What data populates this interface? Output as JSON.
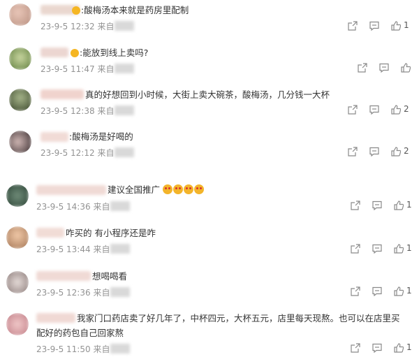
{
  "comments": [
    {
      "text": ":酸梅汤本来就是药房里配制",
      "date": "23-9-5 12:32",
      "source": "来自",
      "likes": "1"
    },
    {
      "text": ":能放到线上卖吗?",
      "date": "23-9-5 11:47",
      "source": "来自",
      "likes": ""
    },
    {
      "text": "真的好想回到小时候，大街上卖大碗茶，酸梅汤，几分钱一大杯",
      "date": "23-9-5 12:38",
      "source": "来自",
      "likes": "2"
    },
    {
      "text": ":酸梅汤是好喝的",
      "date": "23-9-5 12:12",
      "source": "来自",
      "likes": "2"
    },
    {
      "text": "建议全国推广",
      "date": "23-9-5 14:36",
      "source": "来自",
      "likes": "1"
    },
    {
      "text": "咋买的 有小程序还是咋",
      "date": "23-9-5 13:44",
      "source": "来自",
      "likes": "1"
    },
    {
      "text": "想喝喝看",
      "date": "23-9-5 12:36",
      "source": "来自",
      "likes": "1"
    },
    {
      "text": "我家门口药店卖了好几年了，中杯四元，大杯五元，店里每天现熬。也可以在店里买",
      "text2": "配好的药包自己回家熬",
      "date": "23-9-5 11:50",
      "source": "来自",
      "likes": "1"
    }
  ],
  "icons": {
    "share": "share-icon",
    "reply": "comment-icon",
    "like": "thumbs-up-icon",
    "crown": "crown-badge-icon"
  },
  "colors": {
    "meta": "#939393",
    "text": "#333333"
  }
}
